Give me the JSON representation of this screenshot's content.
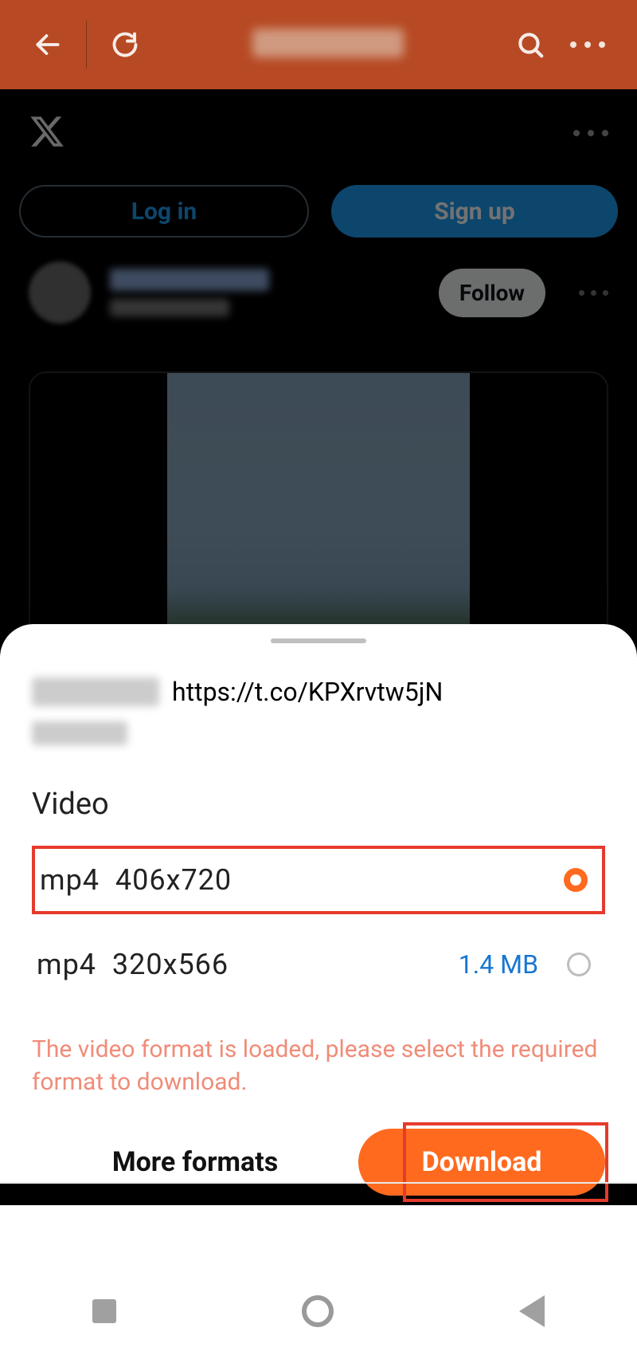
{
  "browser": {
    "address_blurred": true
  },
  "page": {
    "login_label": "Log in",
    "signup_label": "Sign up",
    "follow_label": "Follow"
  },
  "sheet": {
    "url": "https://t.co/KPXrvtw5jN",
    "section_title": "Video",
    "formats": [
      {
        "format": "mp4",
        "resolution": "406x720",
        "size": "",
        "selected": true
      },
      {
        "format": "mp4",
        "resolution": "320x566",
        "size": "1.4 MB",
        "selected": false
      }
    ],
    "notice": "The video format is loaded, please select the required format to download.",
    "more_formats_label": "More formats",
    "download_label": "Download"
  }
}
